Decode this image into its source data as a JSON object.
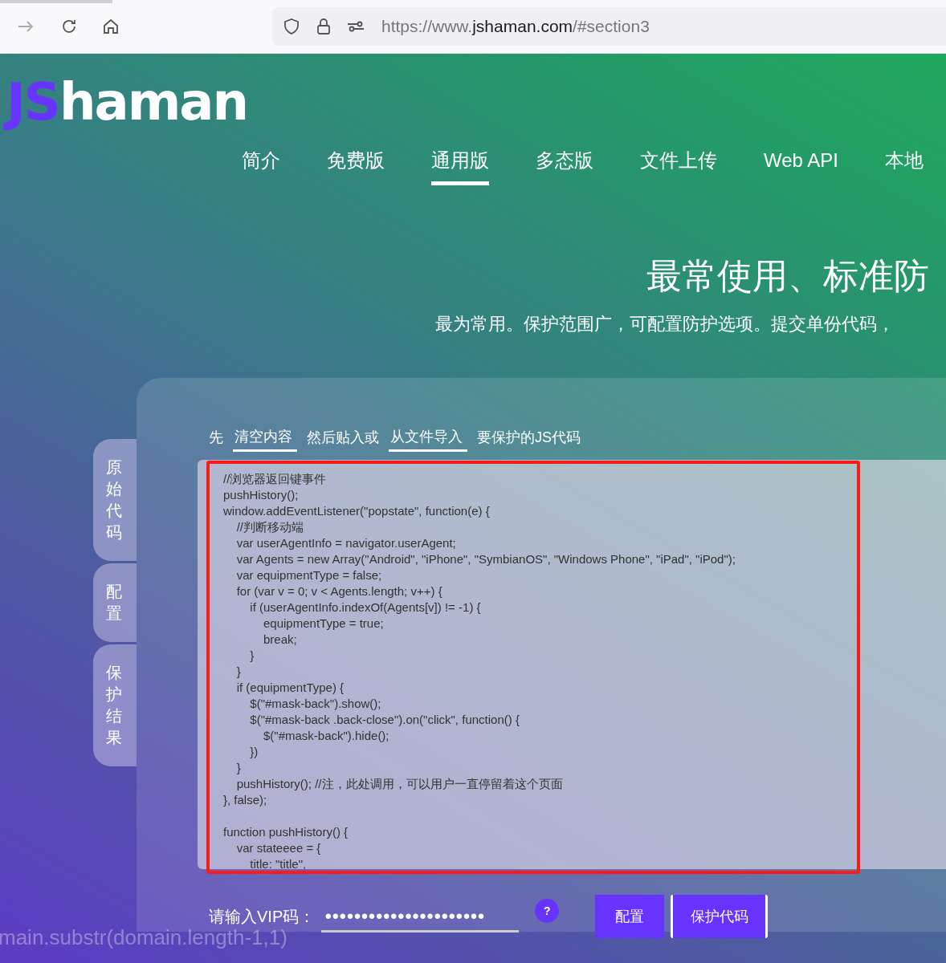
{
  "browser": {
    "url_prefix": "https://www.",
    "url_host": "jshaman.com",
    "url_path": "/#section3"
  },
  "logo": {
    "accent": "JS",
    "rest": "haman"
  },
  "nav": [
    {
      "label": "简介",
      "selected": false
    },
    {
      "label": "免费版",
      "selected": false
    },
    {
      "label": "通用版",
      "selected": true
    },
    {
      "label": "多态版",
      "selected": false
    },
    {
      "label": "文件上传",
      "selected": false
    },
    {
      "label": "Web API",
      "selected": false
    },
    {
      "label": "本地",
      "selected": false
    }
  ],
  "heading": "最常使用、标准防",
  "subtitle": "最为常用。保护范围广，可配置防护选项。提交单份代码，",
  "background_code": "main.substr(domain.length-1,1)",
  "side_tabs": [
    {
      "label": "原始代码"
    },
    {
      "label": "配置"
    },
    {
      "label": "保护结果"
    }
  ],
  "instruction": [
    {
      "kind": "text",
      "text": "先"
    },
    {
      "kind": "link",
      "text": "清空内容"
    },
    {
      "kind": "text",
      "text": "然后贴入或"
    },
    {
      "kind": "link",
      "text": "从文件导入"
    },
    {
      "kind": "text",
      "text": "要保护的JS代码"
    }
  ],
  "code_blocks": [
    [
      "//浏览器返回键事件",
      "pushHistory();",
      "window.addEventListener(\"popstate\", function(e) {",
      "    //判断移动端",
      "    var userAgentInfo = navigator.userAgent;",
      "    var Agents = new Array(\"Android\", \"iPhone\", \"SymbianOS\", \"Windows Phone\", \"iPad\", \"iPod\");",
      "    var equipmentType = false;",
      "    for (var v = 0; v < Agents.length; v++) {",
      "        if (userAgentInfo.indexOf(Agents[v]) != -1) {",
      "            equipmentType = true;",
      "            break;",
      "        }",
      "    }",
      "    if (equipmentType) {",
      "        $(\"#mask-back\").show();",
      "        $(\"#mask-back .back-close\").on(\"click\", function() {",
      "            $(\"#mask-back\").hide();",
      "        })",
      "    }",
      "    pushHistory(); //注，此处调用，可以用户一直停留着这个页面",
      "}, false);"
    ],
    [
      "function pushHistory() {",
      "    var stateeee = {",
      "        title: \"title\","
    ]
  ],
  "vip": {
    "label": "请输入VIP码：",
    "value": "●●●●●●●●●●●●●●●●●●●●●●"
  },
  "help": "?",
  "buttons": [
    "配置",
    "保护代码"
  ]
}
